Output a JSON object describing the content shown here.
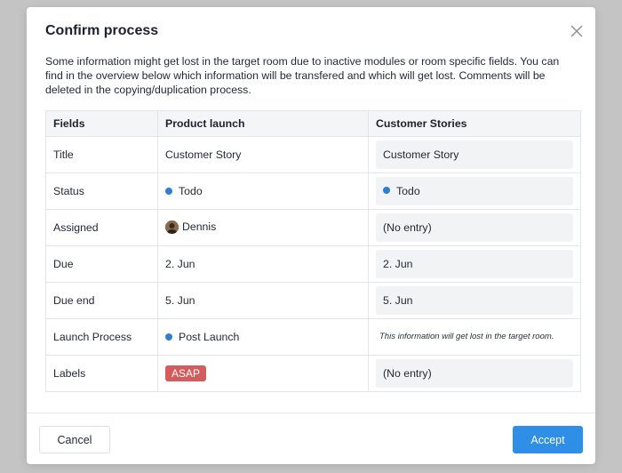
{
  "dialog": {
    "title": "Confirm process",
    "description": "Some information might get lost in the target room due to inactive modules or room specific fields. You can find in the overview below which information will be transfered and which will get lost. Comments will be deleted in the copying/duplication process.",
    "cancel_label": "Cancel",
    "accept_label": "Accept"
  },
  "table": {
    "headers": [
      "Fields",
      "Product launch",
      "Customer Stories"
    ],
    "rows": [
      {
        "field": "Title",
        "source": "Customer Story",
        "target": "Customer Story"
      },
      {
        "field": "Status",
        "source": "Todo",
        "target": "Todo"
      },
      {
        "field": "Assigned",
        "source": "Dennis",
        "target": "(No entry)"
      },
      {
        "field": "Due",
        "source": "2. Jun",
        "target": "2. Jun"
      },
      {
        "field": "Due end",
        "source": "5. Jun",
        "target": "5. Jun"
      },
      {
        "field": "Launch Process",
        "source": "Post Launch",
        "target": "This information will get lost in the target room."
      },
      {
        "field": "Labels",
        "source": "ASAP",
        "target": "(No entry)"
      }
    ]
  },
  "colors": {
    "status_dot": "#2f7fcf",
    "tag_asap": "#d45c5c",
    "accept_button": "#2f8fe6",
    "overlay": "#c4c4c4"
  },
  "icons": {
    "close": "close-icon",
    "status": "status-dot-icon",
    "avatar": "avatar"
  }
}
